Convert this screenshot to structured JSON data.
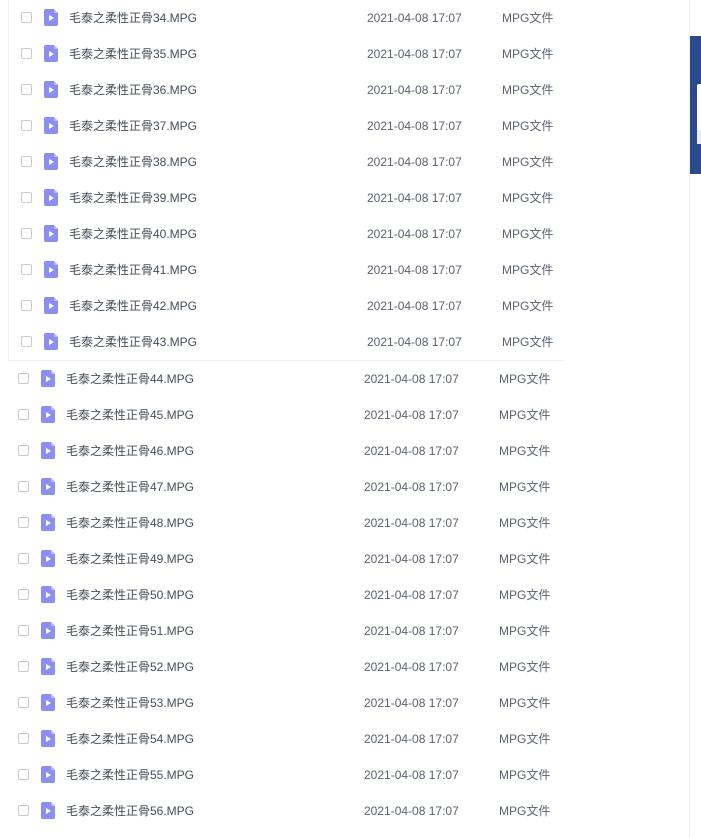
{
  "colors": {
    "file_icon": "#8a8ff0",
    "file_icon_play": "#ffffff",
    "sidebar_accent": "#2a4a8b"
  },
  "icons": {
    "file": "video-file-icon",
    "checkbox": "checkbox"
  },
  "files": [
    {
      "name": "毛泰之柔性正骨34.MPG",
      "date": "2021-04-08 17:07",
      "type": "MPG文件"
    },
    {
      "name": "毛泰之柔性正骨35.MPG",
      "date": "2021-04-08 17:07",
      "type": "MPG文件"
    },
    {
      "name": "毛泰之柔性正骨36.MPG",
      "date": "2021-04-08 17:07",
      "type": "MPG文件"
    },
    {
      "name": "毛泰之柔性正骨37.MPG",
      "date": "2021-04-08 17:07",
      "type": "MPG文件"
    },
    {
      "name": "毛泰之柔性正骨38.MPG",
      "date": "2021-04-08 17:07",
      "type": "MPG文件"
    },
    {
      "name": "毛泰之柔性正骨39.MPG",
      "date": "2021-04-08 17:07",
      "type": "MPG文件"
    },
    {
      "name": "毛泰之柔性正骨40.MPG",
      "date": "2021-04-08 17:07",
      "type": "MPG文件"
    },
    {
      "name": "毛泰之柔性正骨41.MPG",
      "date": "2021-04-08 17:07",
      "type": "MPG文件"
    },
    {
      "name": "毛泰之柔性正骨42.MPG",
      "date": "2021-04-08 17:07",
      "type": "MPG文件"
    },
    {
      "name": "毛泰之柔性正骨43.MPG",
      "date": "2021-04-08 17:07",
      "type": "MPG文件"
    },
    {
      "name": "毛泰之柔性正骨44.MPG",
      "date": "2021-04-08 17:07",
      "type": "MPG文件"
    },
    {
      "name": "毛泰之柔性正骨45.MPG",
      "date": "2021-04-08 17:07",
      "type": "MPG文件"
    },
    {
      "name": "毛泰之柔性正骨46.MPG",
      "date": "2021-04-08 17:07",
      "type": "MPG文件"
    },
    {
      "name": "毛泰之柔性正骨47.MPG",
      "date": "2021-04-08 17:07",
      "type": "MPG文件"
    },
    {
      "name": "毛泰之柔性正骨48.MPG",
      "date": "2021-04-08 17:07",
      "type": "MPG文件"
    },
    {
      "name": "毛泰之柔性正骨49.MPG",
      "date": "2021-04-08 17:07",
      "type": "MPG文件"
    },
    {
      "name": "毛泰之柔性正骨50.MPG",
      "date": "2021-04-08 17:07",
      "type": "MPG文件"
    },
    {
      "name": "毛泰之柔性正骨51.MPG",
      "date": "2021-04-08 17:07",
      "type": "MPG文件"
    },
    {
      "name": "毛泰之柔性正骨52.MPG",
      "date": "2021-04-08 17:07",
      "type": "MPG文件"
    },
    {
      "name": "毛泰之柔性正骨53.MPG",
      "date": "2021-04-08 17:07",
      "type": "MPG文件"
    },
    {
      "name": "毛泰之柔性正骨54.MPG",
      "date": "2021-04-08 17:07",
      "type": "MPG文件"
    },
    {
      "name": "毛泰之柔性正骨55.MPG",
      "date": "2021-04-08 17:07",
      "type": "MPG文件"
    },
    {
      "name": "毛泰之柔性正骨56.MPG",
      "date": "2021-04-08 17:07",
      "type": "MPG文件"
    }
  ]
}
